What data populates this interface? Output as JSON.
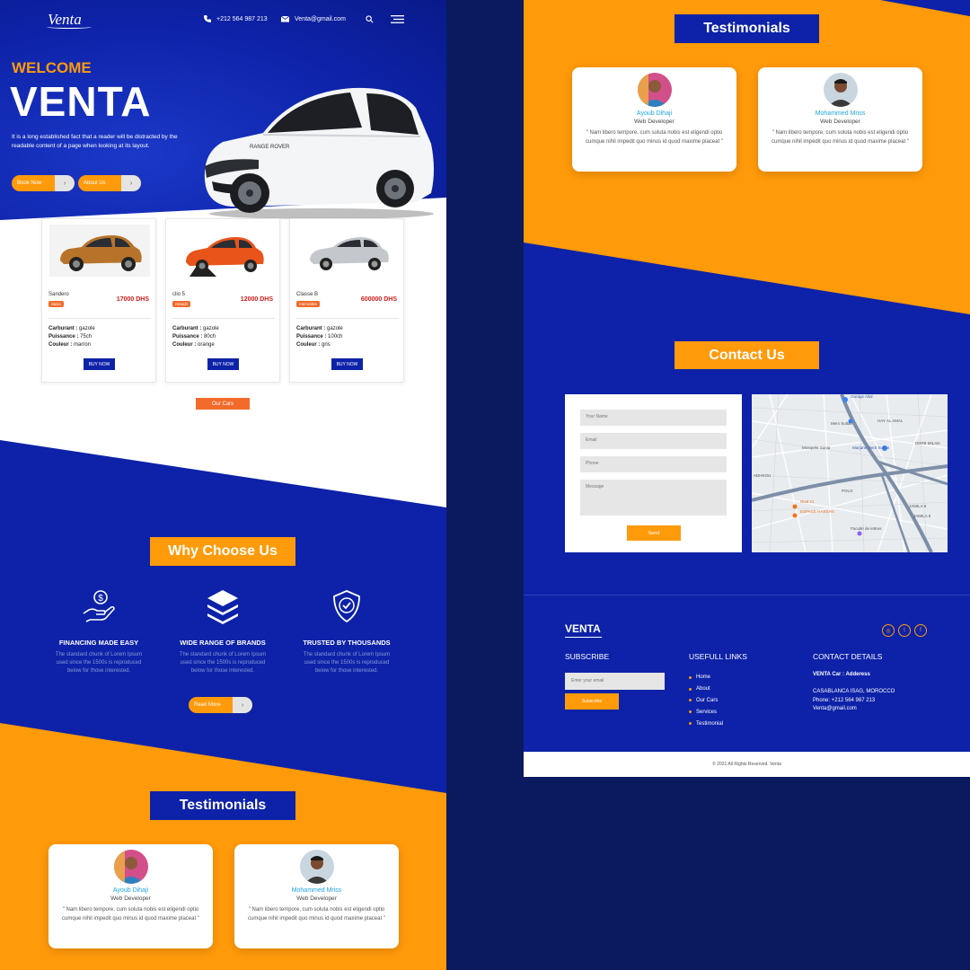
{
  "brand": {
    "logo": "Venta"
  },
  "nav": {
    "phone": "+212 564 987 213",
    "email": "Venta@gmail.com"
  },
  "hero": {
    "welcome": "WELCOME",
    "title": "VENTA",
    "description": "It is a long established fact that a reader will be distracted by the readable content of a page when looking at its layout.",
    "book_now": "Book Now",
    "about_us": "About Us"
  },
  "cars": [
    {
      "name": "Sandero",
      "brand": "dacia",
      "price": "17000 DHS",
      "carburant": "gazole",
      "puissance": "75ch",
      "couleur": "marron",
      "buy": "BUY NOW",
      "color": "#b8732a"
    },
    {
      "name": "clio 5",
      "brand": "renault",
      "price": "12000 DHS",
      "carburant": "gazole",
      "puissance": "80ch",
      "couleur": "orange",
      "buy": "BUY NOW",
      "color": "#e8541a"
    },
    {
      "name": "Classe B",
      "brand": "mercedes",
      "price": "600000 DHS",
      "carburant": "gazole",
      "puissance": "100ch",
      "couleur": "gris",
      "buy": "BUY NOW",
      "color": "#b9bcc1"
    }
  ],
  "spec_labels": {
    "carburant": "Carburant :",
    "puissance": "Puissance :",
    "couleur": "Couleur :"
  },
  "our_cars_button": "Our Cars",
  "why": {
    "title": "Why Choose Us",
    "features": [
      {
        "title": "FINANCING MADE EASY",
        "text": "The standard chunk of Lorem Ipsum used since the 1500s is reproduced below for those interested."
      },
      {
        "title": "WIDE RANGE OF BRANDS",
        "text": "The standard chunk of Lorem Ipsum used since the 1500s is reproduced below for those interested."
      },
      {
        "title": "TRUSTED BY THOUSANDS",
        "text": "The standard chunk of Lorem Ipsum used since the 1500s is reproduced below for those interested."
      }
    ],
    "read_more": "Read More"
  },
  "testimonials": {
    "title": "Testimonials",
    "items": [
      {
        "name": "Ayoub Dihaji",
        "role": "Web Developer",
        "quote": "\" Nam libero tempore, cum soluta nobis est eligendi optio cumque nihil impedit quo minus id quod maxime placeat \""
      },
      {
        "name": "Mohammed Mriss",
        "role": "Web Developer",
        "quote": "\" Nam libero tempore, cum soluta nobis est eligendi optio cumque nihil impedit quo minus id quod maxime placeat \""
      }
    ]
  },
  "contact": {
    "title": "Contact Us",
    "placeholders": {
      "name": "Your Name",
      "email": "Email",
      "phone": "Phone",
      "message": "Message"
    },
    "send": "Send"
  },
  "map_labels": [
    "Garage Allal",
    "Mers Sultan",
    "HAY AL AMAL",
    "Mosquée Sonia",
    "Marjane Derb Sultan",
    "DERB MILAN",
    "POLO",
    "ADHKOU",
    "Riad 21",
    "ESPACE HASSAN",
    "JAMILA 5",
    "JAMILA 6",
    "Faculté de lettres"
  ],
  "footer": {
    "brand": "VENTA",
    "subscribe_title": "SUBSCRIBE",
    "email_placeholder": "Enter your email",
    "subscribe_button": "Subscribe",
    "links_title": "USEFULL LINKS",
    "links": [
      "Home",
      "About",
      "Our Cars",
      "Services",
      "Testimonial"
    ],
    "contact_title": "CONTACT DETAILS",
    "company": "VENTA Car : Adderess",
    "address": "CASABLANCA ISAG, MOROCCO",
    "phone": "Phone: +212 564 987 213",
    "email": "Venta@gmail.com",
    "copyright": "© 2021 All Rights Reserved. Venta"
  },
  "colors": {
    "blue": "#0d22a8",
    "orange": "#ff9a0a",
    "dark": "#0b1a5e",
    "price_red": "#d31a1a",
    "name_blue": "#1fa4e0"
  }
}
